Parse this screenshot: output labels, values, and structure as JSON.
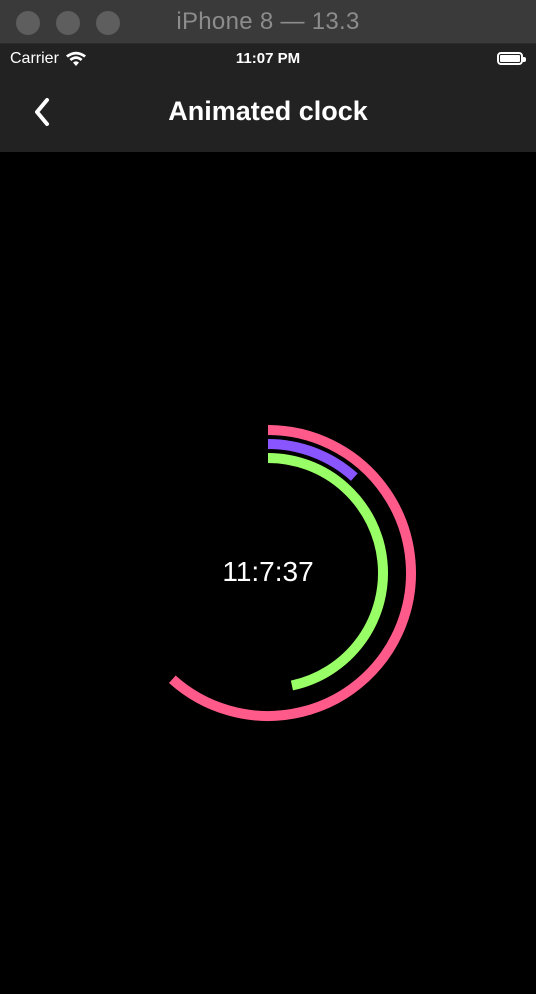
{
  "window": {
    "title": "iPhone 8 — 13.3"
  },
  "status_bar": {
    "carrier": "Carrier",
    "time": "11:07 PM"
  },
  "nav": {
    "title": "Animated clock"
  },
  "clock": {
    "display": "11:7:37",
    "hours": 11,
    "minutes": 7,
    "seconds": 37,
    "colors": {
      "seconds_ring": "#ff5a8a",
      "minutes_ring": "#99ff66",
      "hours_ring": "#8855ff",
      "background": "#000000"
    }
  }
}
